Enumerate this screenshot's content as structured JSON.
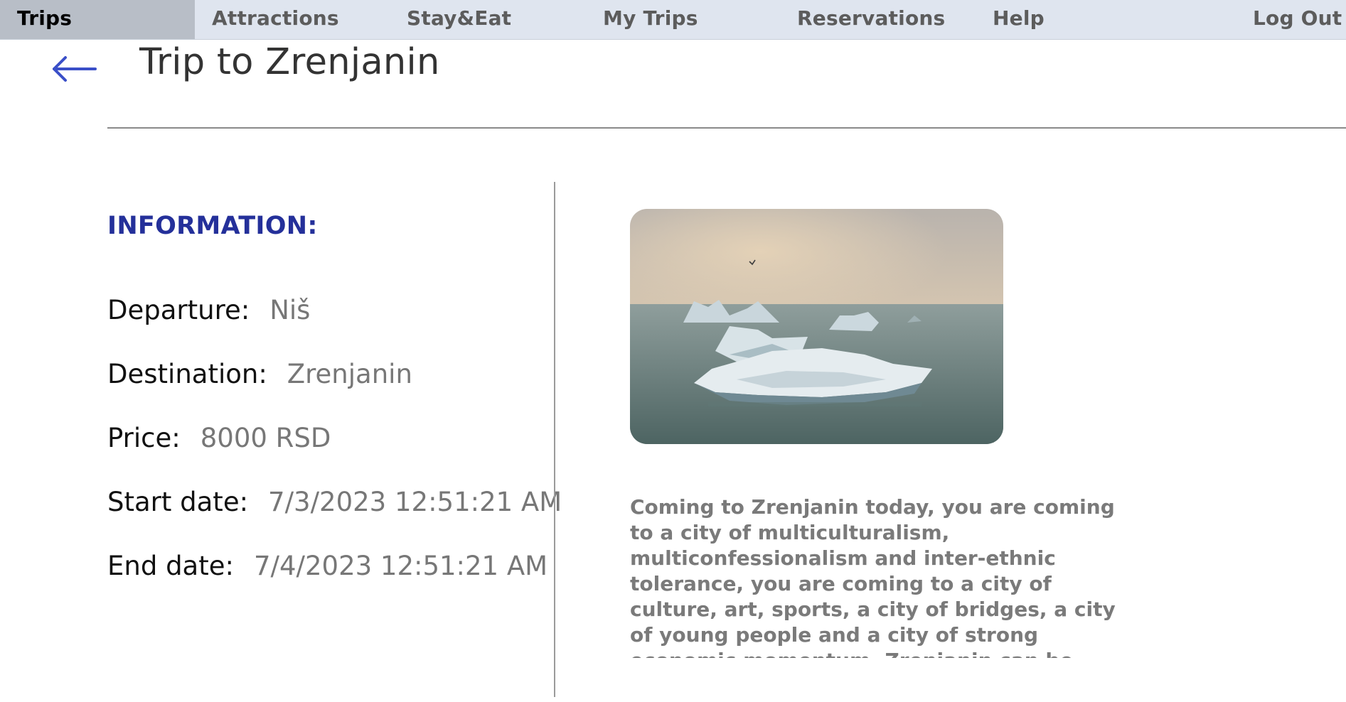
{
  "nav": {
    "items": [
      {
        "label": "Trips",
        "active": true
      },
      {
        "label": "Attractions",
        "active": false
      },
      {
        "label": "Stay&Eat",
        "active": false
      },
      {
        "label": "My Trips",
        "active": false
      },
      {
        "label": "Reservations",
        "active": false
      },
      {
        "label": "Help",
        "active": false
      }
    ],
    "logout_label": "Log Out"
  },
  "header": {
    "back_icon": "arrow-left-icon",
    "title": "Trip to Zrenjanin"
  },
  "info": {
    "heading": "INFORMATION:",
    "rows": [
      {
        "label": "Departure:",
        "value": "Niš"
      },
      {
        "label": "Destination:",
        "value": "Zrenjanin"
      },
      {
        "label": "Price:",
        "value": "8000 RSD"
      },
      {
        "label": "Start date:",
        "value": "7/3/2023 12:51:21 AM"
      },
      {
        "label": "End date:",
        "value": "7/4/2023 12:51:21 AM"
      }
    ]
  },
  "description": {
    "text": "Coming to Zrenjanin today, you are coming to a city of multiculturalism, multiconfessionalism and inter-ethnic tolerance, you are coming to a city of culture, art, sports, a city of bridges, a city of young people and a city of strong economic momentum. Zrenjanin can be recognized by"
  },
  "colors": {
    "nav_bg": "#dfe5ef",
    "nav_active_bg": "#b8bec7",
    "heading_blue": "#24309a",
    "arrow_blue": "#3a4fc8"
  }
}
